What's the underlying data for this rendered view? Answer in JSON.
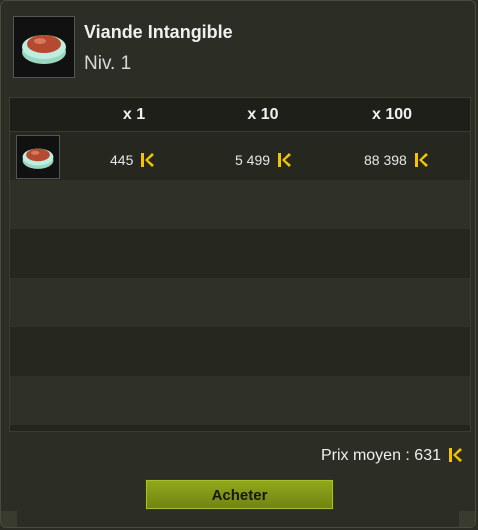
{
  "item": {
    "name": "Viande Intangible",
    "level": "Niv. 1",
    "icon": "steak-icon"
  },
  "table": {
    "columns": [
      "x 1",
      "x 10",
      "x 100"
    ],
    "rows": [
      {
        "icon": "steak-icon",
        "prices": [
          "445",
          "5 499",
          "88 398"
        ],
        "currency_icon": "kama-icon"
      }
    ]
  },
  "footer": {
    "average_price": "Prix moyen : 631",
    "buy_label": "Acheter"
  },
  "colors": {
    "accent": "#8aa01a",
    "kama": "#f5c400",
    "background": "#2c2d24"
  }
}
